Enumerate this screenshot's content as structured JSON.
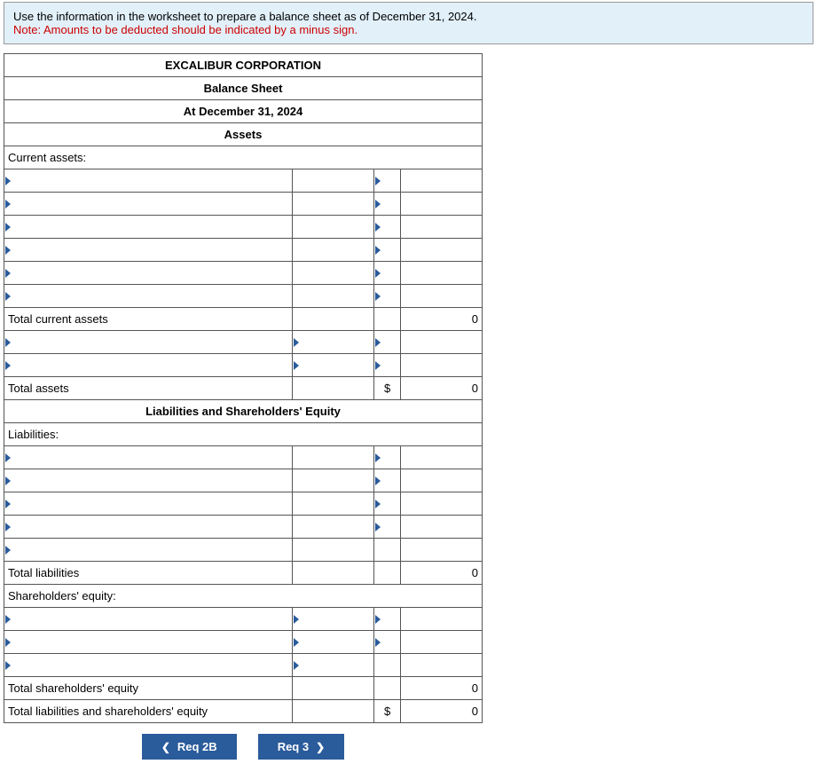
{
  "instructions": {
    "line1": "Use the information in the worksheet to prepare a balance sheet as of December 31, 2024.",
    "line2": "Note: Amounts to be deducted should be indicated by a minus sign."
  },
  "header": {
    "company": "EXCALIBUR CORPORATION",
    "title": "Balance Sheet",
    "date": "At December 31, 2024",
    "section_assets": "Assets",
    "section_liab_eq": "Liabilities and Shareholders' Equity"
  },
  "labels": {
    "current_assets": "Current assets:",
    "total_current_assets": "Total current assets",
    "total_assets": "Total assets",
    "liabilities": "Liabilities:",
    "total_liabilities": "Total liabilities",
    "shareholders_equity": "Shareholders' equity:",
    "total_shareholders_equity": "Total shareholders' equity",
    "total_liab_eq": "Total liabilities and shareholders' equity"
  },
  "values": {
    "dollar": "$",
    "zero": "0"
  },
  "nav": {
    "prev": "Req 2B",
    "next": "Req 3"
  }
}
